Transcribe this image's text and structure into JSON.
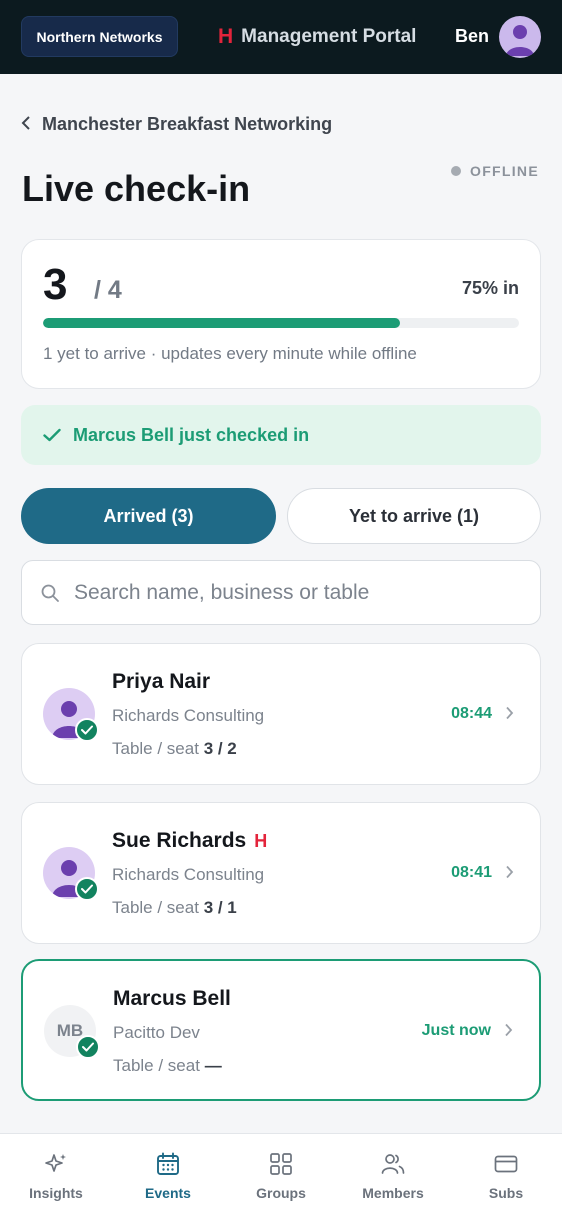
{
  "header": {
    "org_name": "Northern Networks",
    "brand_mark": "H",
    "portal_title": "Management Portal",
    "user_name": "Ben"
  },
  "breadcrumb": {
    "back_label": "Manchester Breakfast Networking"
  },
  "page": {
    "title": "Live check-in",
    "status": "OFFLINE"
  },
  "stats": {
    "checked_in": "3",
    "total_label": "/ 4",
    "percent_label": "75% in",
    "progress_fraction": 0.75,
    "subtitle": "1 yet to arrive · updates every minute while offline"
  },
  "toast": {
    "message": "Marcus Bell just checked in"
  },
  "tabs": [
    {
      "label": "Arrived  (3)",
      "active": true
    },
    {
      "label": "Yet to arrive  (1)",
      "active": false
    }
  ],
  "search": {
    "placeholder": "Search name, business or table",
    "value": ""
  },
  "attendees": [
    {
      "name": "Priya Nair",
      "business": "Richards Consulting",
      "seat_label": "Table / seat",
      "seat": "3 / 2",
      "time": "08:44",
      "badge": ""
    },
    {
      "name": "Sue Richards",
      "business": "Richards Consulting",
      "seat_label": "Table / seat",
      "seat": "3 / 1",
      "time": "08:41",
      "badge": "H"
    },
    {
      "name": "Marcus Bell",
      "initials": "MB",
      "business": "Pacitto Dev",
      "seat_label": "Table / seat",
      "seat": "—",
      "time": "Just now",
      "badge": ""
    }
  ],
  "nav": [
    {
      "label": "Insights",
      "icon": "sparkle-icon"
    },
    {
      "label": "Events",
      "icon": "calendar-icon",
      "active": true
    },
    {
      "label": "Groups",
      "icon": "grid-icon"
    },
    {
      "label": "Members",
      "icon": "members-icon"
    },
    {
      "label": "Subs",
      "icon": "card-icon"
    }
  ],
  "colors": {
    "accent": "#1f6a87",
    "success": "#1c9c75",
    "brand_red": "#e3243b",
    "topbar": "#0c1a1f"
  }
}
